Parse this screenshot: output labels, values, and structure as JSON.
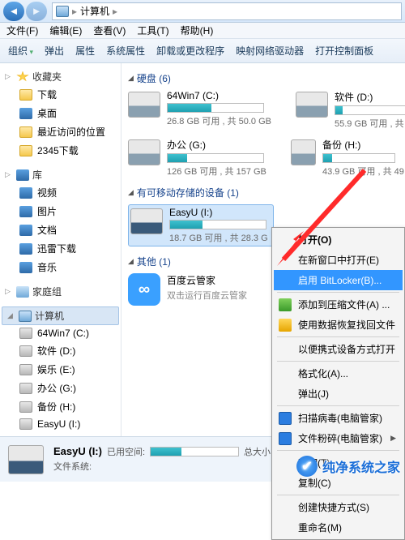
{
  "address": {
    "location": "计算机",
    "sep": "▸"
  },
  "menu": {
    "file": "文件(F)",
    "edit": "编辑(E)",
    "view": "查看(V)",
    "tools": "工具(T)",
    "help": "帮助(H)"
  },
  "toolbar": {
    "organize": "组织",
    "eject": "弹出",
    "properties": "属性",
    "syssettings": "系统属性",
    "uninstall": "卸载或更改程序",
    "netdrive": "映射网络驱动器",
    "controlpanel": "打开控制面板"
  },
  "sidebar": {
    "fav_head": "收藏夹",
    "fav": [
      "下载",
      "桌面",
      "最近访问的位置",
      "2345下载"
    ],
    "lib_head": "库",
    "lib": [
      "视频",
      "图片",
      "文档",
      "迅雷下载",
      "音乐"
    ],
    "home_head": "家庭组",
    "comp_head": "计算机",
    "drives": [
      "64Win7 (C:)",
      "软件 (D:)",
      "娱乐 (E:)",
      "办公 (G:)",
      "备份 (H:)",
      "EasyU (I:)"
    ]
  },
  "content": {
    "hdd_head": "硬盘 (6)",
    "removable_head": "有可移动存储的设备 (1)",
    "other_head": "其他 (1)",
    "drives": {
      "c": {
        "name": "64Win7 (C:)",
        "usage": "26.8 GB 可用 , 共 50.0 GB",
        "pct": 46
      },
      "d": {
        "name": "软件 (D:)",
        "usage": "55.9 GB 可用 , 共",
        "pct": 10
      },
      "g": {
        "name": "办公 (G:)",
        "usage": "126 GB 可用 , 共 157 GB",
        "pct": 20
      },
      "h": {
        "name": "备份 (H:)",
        "usage": "43.9 GB 可用 , 共 49",
        "pct": 12
      },
      "i": {
        "name": "EasyU (I:)",
        "usage": "18.7 GB 可用 , 共 28.3 G",
        "pct": 34
      }
    },
    "other": {
      "name": "百度云管家",
      "desc": "双击运行百度云管家",
      "glyph": "∞"
    }
  },
  "context": {
    "open": "打开(O)",
    "newwin": "在新窗口中打开(E)",
    "bitlocker": "启用 BitLocker(B)...",
    "addzip": "添加到压缩文件(A) ...",
    "recover": "使用数据恢复找回文件",
    "portable": "以便携式设备方式打开",
    "format": "格式化(A)...",
    "eject": "弹出(J)",
    "scan": "扫描病毒(电脑管家)",
    "shred": "文件粉碎(电脑管家)",
    "cut": "剪切(T)",
    "copy": "复制(C)",
    "shortcut": "创建快捷方式(S)",
    "rename": "重命名(M)"
  },
  "bottom": {
    "name": "EasyU (I:)",
    "used_label": "已用空间:",
    "total_label": "总大小:",
    "fs_label": "文件系统:"
  },
  "watermark": "纯净系统之家"
}
